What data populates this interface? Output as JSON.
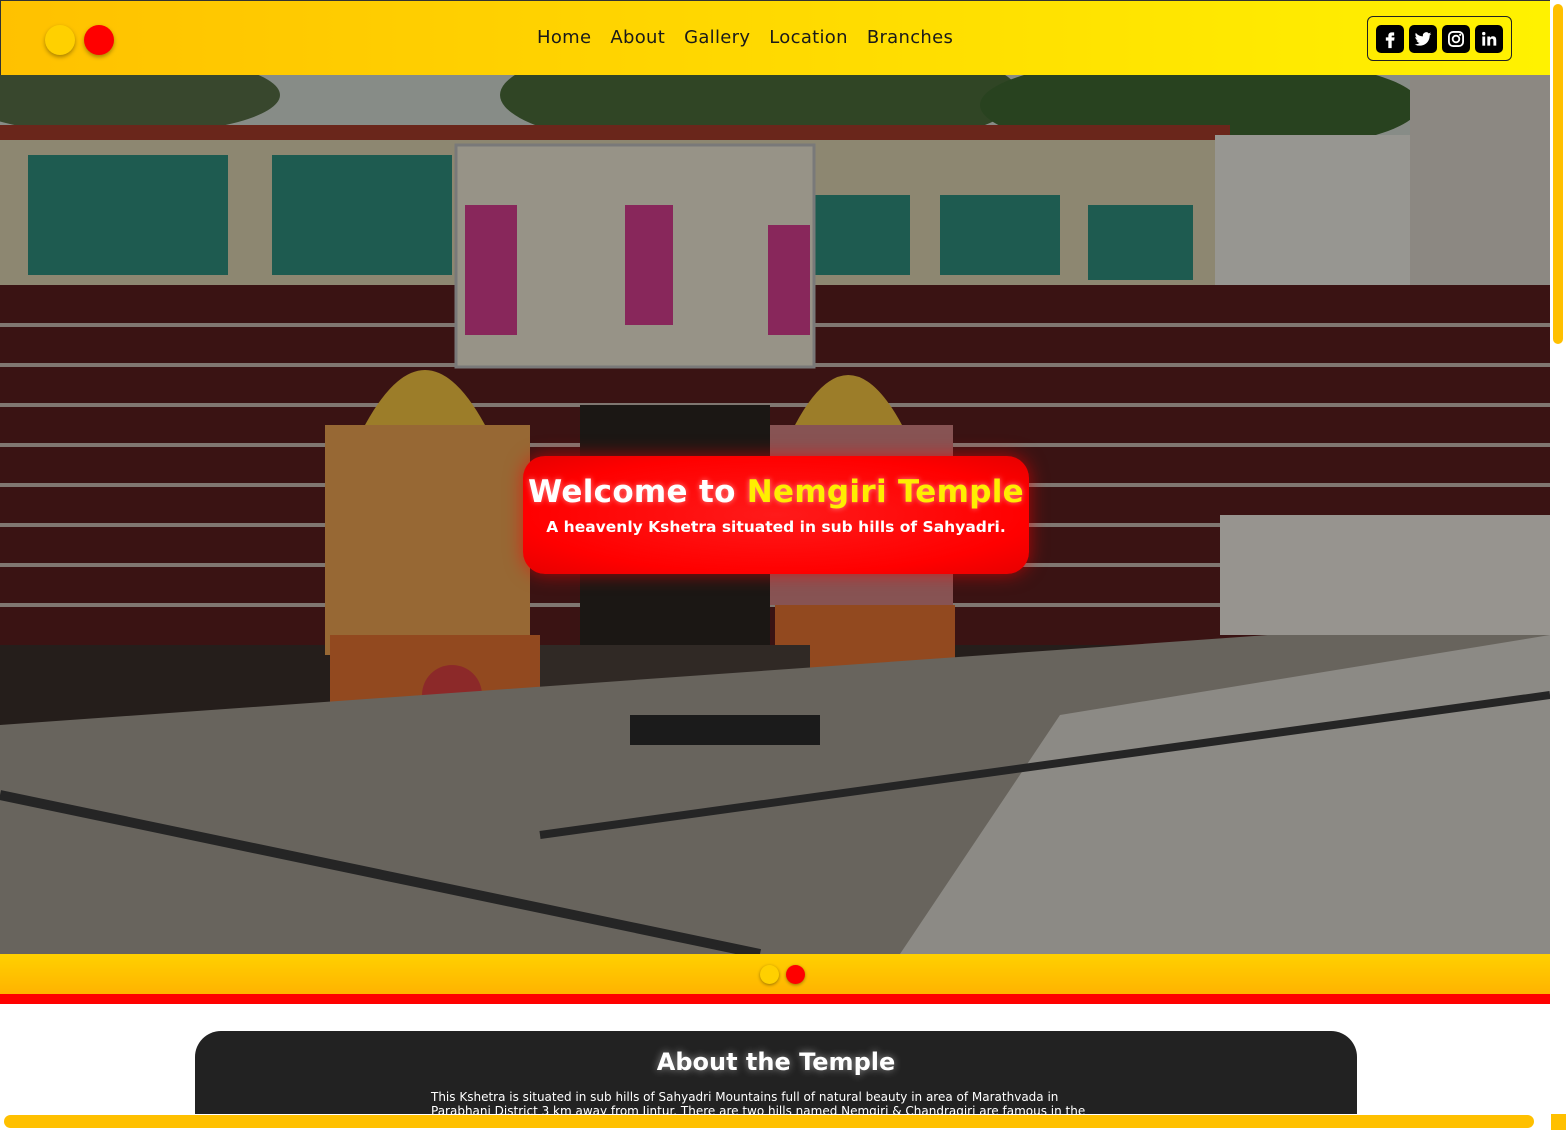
{
  "header": {
    "nav": [
      "Home",
      "About",
      "Gallery",
      "Location",
      "Branches"
    ],
    "social": [
      "facebook",
      "twitter",
      "instagram",
      "linkedin"
    ],
    "colors": {
      "yellow": "#ffd000",
      "red": "#ff0000"
    }
  },
  "hero": {
    "title_prefix": "Welcome to ",
    "title_highlight": "Nemgiri Temple",
    "subtitle": "A heavenly Kshetra situated in sub hills of Sahyadri."
  },
  "about": {
    "title": "About the Temple",
    "text": "This Kshetra is situated in sub hills of Sahyadri Mountains full of natural beauty in area of Marathvada in Parabhani District 3 km away from Jintur. There are two hills named Nemgiri & Chandragiri are famous in the"
  }
}
